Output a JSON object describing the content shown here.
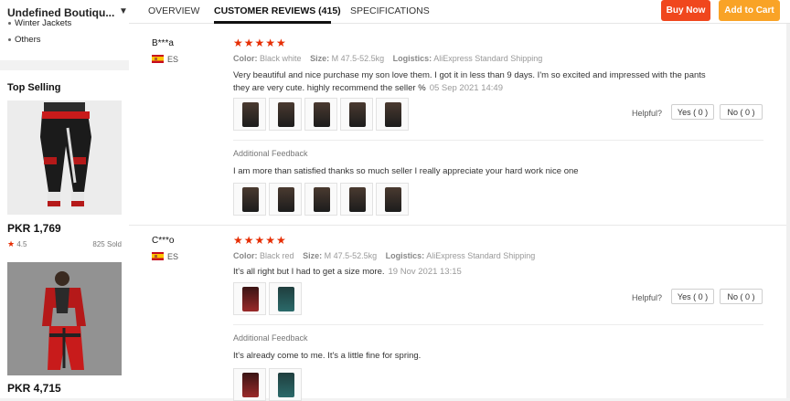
{
  "sidebar": {
    "store_name": "Undefined Boutiqu...",
    "categories": [
      "Winter Jackets",
      "Others"
    ],
    "top_selling_title": "Top Selling",
    "products": [
      {
        "price": "PKR 1,769",
        "rating": "4.5",
        "sold": "825 Sold"
      },
      {
        "price": "PKR 4,715"
      }
    ]
  },
  "tabs": [
    {
      "label": "OVERVIEW"
    },
    {
      "label": "CUSTOMER REVIEWS (415)"
    },
    {
      "label": "SPECIFICATIONS"
    }
  ],
  "actions": {
    "buy_now": "Buy Now",
    "add_to_cart": "Add to Cart"
  },
  "colors": {
    "accent": "#e62e04",
    "buy": "#f0471d",
    "cart": "#f9a326"
  },
  "labels": {
    "color": "Color:",
    "size": "Size:",
    "logistics": "Logistics:",
    "helpful": "Helpful?",
    "additional_feedback": "Additional Feedback",
    "stars": "★★★★★"
  },
  "reviews": [
    {
      "name": "B***a",
      "country": "ES",
      "color": "Black white",
      "size": "M 47.5-52.5kg",
      "logistics": "AliExpress Standard Shipping",
      "text": "Very beautiful and nice purchase my son love them. I got it in less than 9 days. I'm so excited and impressed with the pants they are very cute. highly recommend the seller %",
      "date": "05 Sep 2021 14:49",
      "yes": "Yes ( 0 )",
      "no": "No ( 0 )",
      "additional": "I am more than satisfied thanks so much seller I really appreciate your hard work nice one"
    },
    {
      "name": "C***o",
      "country": "ES",
      "color": "Black red",
      "size": "M 47.5-52.5kg",
      "logistics": "AliExpress Standard Shipping",
      "text": "It's all right but I had to get a size more.",
      "date": "19 Nov 2021 13:15",
      "yes": "Yes ( 0 )",
      "no": "No ( 0 )",
      "additional": "It's already come to me. It's a little fine for spring."
    }
  ]
}
